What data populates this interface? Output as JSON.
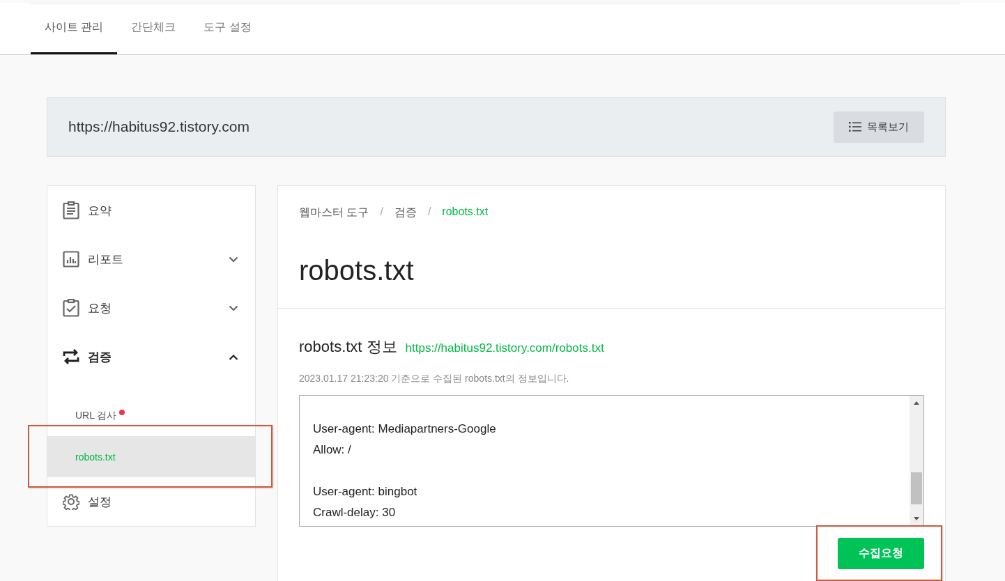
{
  "top_tabs": [
    {
      "label": "사이트 관리",
      "selected": true
    },
    {
      "label": "간단체크",
      "selected": false
    },
    {
      "label": "도구 설정",
      "selected": false
    }
  ],
  "site_bar": {
    "url": "https://habitus92.tistory.com",
    "list_button": "목록보기"
  },
  "sidebar": {
    "items": [
      {
        "label": "요약",
        "selected": false
      },
      {
        "label": "리포트",
        "selected": false,
        "expanded": false
      },
      {
        "label": "요청",
        "selected": false,
        "expanded": false
      },
      {
        "label": "검증",
        "selected": true,
        "expanded": true,
        "children": [
          {
            "label": "URL 검사",
            "selected": false,
            "new": true,
            "highlighted": false
          },
          {
            "label": "robots.txt",
            "selected": true,
            "new": false,
            "highlighted": true
          }
        ]
      },
      {
        "label": "설정",
        "selected": false
      }
    ]
  },
  "breadcrumb": {
    "separator": "/",
    "items": [
      {
        "label": "웹마스터 도구",
        "current": false
      },
      {
        "label": "검증",
        "current": false
      },
      {
        "label": "robots.txt",
        "current": true
      }
    ]
  },
  "page_title": "robots.txt",
  "section": {
    "title": "robots.txt 정보",
    "link": "https://habitus92.tistory.com/robots.txt",
    "note": "2023.01.17 21:23:20 기준으로 수집된 robots.txt의 정보입니다.",
    "content": "\nUser-agent: Mediapartners-Google\nAllow: /\n\nUser-agent: bingbot\nCrawl-delay: 30",
    "button": {
      "label": "수집요청",
      "highlighted": true
    }
  }
}
